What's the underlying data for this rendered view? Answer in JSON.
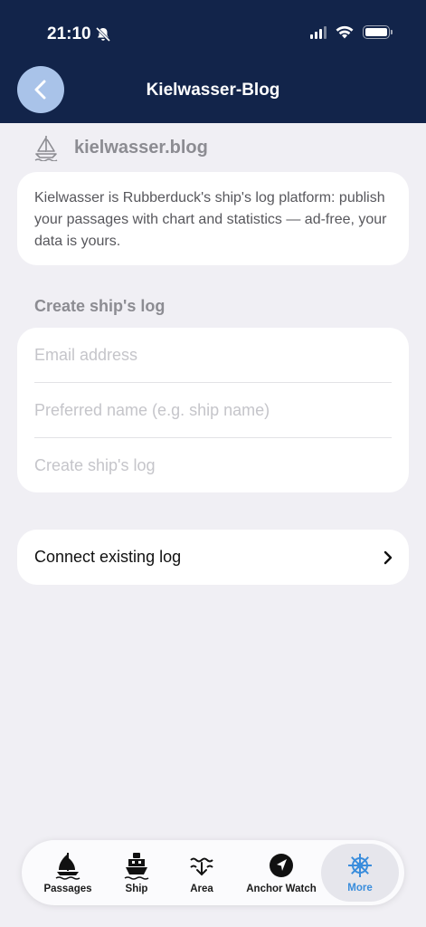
{
  "status_bar": {
    "time": "21:10"
  },
  "header": {
    "title": "Kielwasser-Blog"
  },
  "site": {
    "name": "kielwasser.blog"
  },
  "description": "Kielwasser is Rubberduck's ship's log platform: publish your passages with chart and statistics — ad-free, your data is yours.",
  "form": {
    "section_title": "Create ship's log",
    "email_placeholder": "Email address",
    "name_placeholder": "Preferred name (e.g. ship name)",
    "submit_label": "Create ship's log"
  },
  "connect": {
    "label": "Connect existing log"
  },
  "tabs": [
    {
      "label": "Passages",
      "icon": "sailboat-icon",
      "active": false
    },
    {
      "label": "Ship",
      "icon": "ship-icon",
      "active": false
    },
    {
      "label": "Area",
      "icon": "area-icon",
      "active": false
    },
    {
      "label": "Anchor Watch",
      "icon": "navigation-arrow-icon",
      "active": false
    },
    {
      "label": "More",
      "icon": "helm-wheel-icon",
      "active": true
    }
  ],
  "colors": {
    "header_bg": "#12244a",
    "accent": "#3a8ddc",
    "back_button": "#a9c3e9"
  }
}
